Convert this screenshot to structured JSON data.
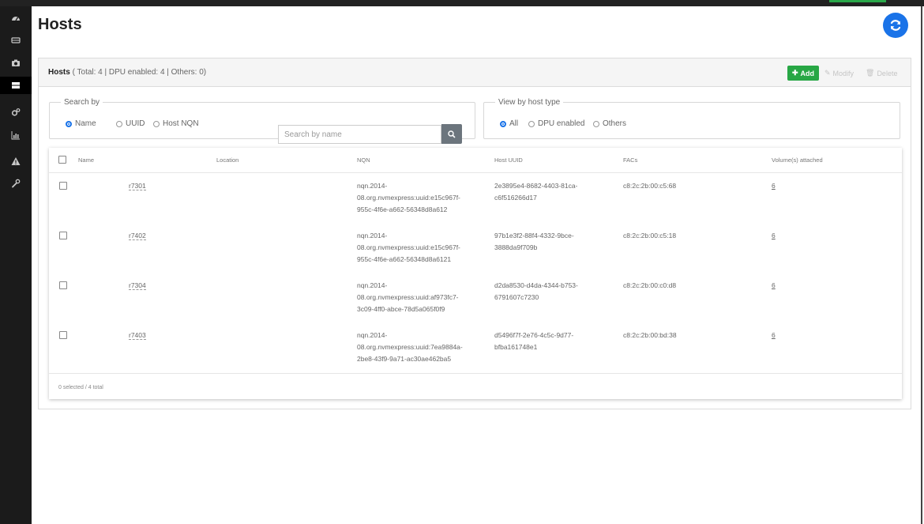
{
  "page": {
    "title": "Hosts"
  },
  "sidebar": {
    "items": [
      {
        "icon": "dashboard-icon"
      },
      {
        "icon": "storage-icon"
      },
      {
        "icon": "camera-icon"
      },
      {
        "icon": "server-icon",
        "active": true
      },
      {
        "icon": "cogs-icon"
      },
      {
        "icon": "bar-chart-icon"
      },
      {
        "icon": "warning-icon"
      },
      {
        "icon": "wrench-icon"
      }
    ]
  },
  "panel": {
    "title": "Hosts",
    "summary": "( Total: 4 | DPU enabled: 4 | Others: 0)",
    "add_label": "Add",
    "modify_label": "Modify",
    "delete_label": "Delete"
  },
  "search": {
    "legend": "Search by",
    "options": [
      "Name",
      "UUID",
      "Host NQN"
    ],
    "selected": "Name",
    "placeholder": "Search by name"
  },
  "view": {
    "legend": "View by host type",
    "options": [
      "All",
      "DPU enabled",
      "Others"
    ],
    "selected": "All"
  },
  "table": {
    "columns": [
      "Name",
      "Location",
      "NQN",
      "Host UUID",
      "FACs",
      "Volume(s) attached"
    ],
    "rows": [
      {
        "name": "r7301",
        "location": "",
        "nqn": [
          "nqn.2014-",
          "08.org.nvmexpress:uuid:e15c967f-",
          "955c-4f6e-a662-56348d8a612"
        ],
        "uuid": [
          "2e3895e4-8682-4403-81ca-",
          "c6f516266d17"
        ],
        "facs": "c8:2c:2b:00:c5:68",
        "volumes": "6"
      },
      {
        "name": "r7402",
        "location": "",
        "nqn": [
          "nqn.2014-",
          "08.org.nvmexpress:uuid:e15c967f-",
          "955c-4f6e-a662-56348d8a6121"
        ],
        "uuid": [
          "97b1e3f2-88f4-4332-9bce-",
          "3888da9f709b"
        ],
        "facs": "c8:2c:2b:00:c5:18",
        "volumes": "6"
      },
      {
        "name": "r7304",
        "location": "",
        "nqn": [
          "nqn.2014-",
          "08.org.nvmexpress:uuid:af973fc7-",
          "3c09-4ff0-abce-78d5a065f0f9"
        ],
        "uuid": [
          "d2da8530-d4da-4344-b753-",
          "6791607c7230"
        ],
        "facs": "c8:2c:2b:00:c0:d8",
        "volumes": "6"
      },
      {
        "name": "r7403",
        "location": "",
        "nqn": [
          "nqn.2014-",
          "08.org.nvmexpress:uuid:7ea9884a-",
          "2be8-43f9-9a71-ac30ae462ba5"
        ],
        "uuid": [
          "d5496f7f-2e76-4c5c-9d77-",
          "bfba161748e1"
        ],
        "facs": "c8:2c:2b:00:bd:38",
        "volumes": "6"
      }
    ],
    "footer": "0 selected / 4 total"
  },
  "colors": {
    "accent": "#1a73e8",
    "add": "#28a745",
    "sidebar": "#1b1b1b"
  }
}
